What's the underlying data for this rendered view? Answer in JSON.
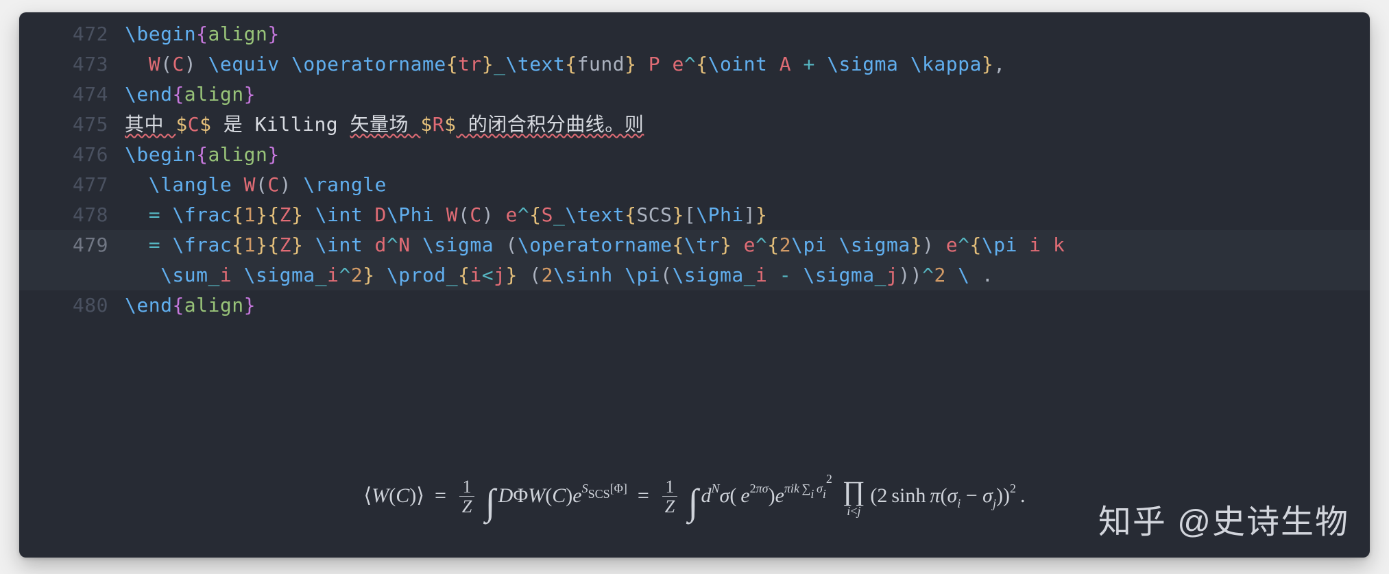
{
  "editor": {
    "line_numbers": [
      "472",
      "473",
      "474",
      "475",
      "476",
      "477",
      "478",
      "479",
      "",
      "480"
    ],
    "current_line_index": 8
  },
  "code": {
    "l472": {
      "space": "",
      "begin": "\\begin",
      "lb": "{",
      "env": "align",
      "rb": "}"
    },
    "l473": {
      "indent": "  ",
      "W": "W",
      "lp": "(",
      "C": "C",
      "rp": ")",
      " ": " ",
      "equiv": "\\equiv",
      " 2": " ",
      "opname": "\\operatorname",
      "lb": "{",
      "tr": "tr",
      "rb": "}",
      "us": "_",
      "text": "\\text",
      "lb2": "{",
      "fund": "fund",
      "rb2": "}",
      " 3": " ",
      "P": "P",
      " 4": " ",
      "e": "e",
      "caret": "^",
      "lb3": "{",
      "oint": "\\oint",
      " 5": " ",
      "A": "A",
      " 6": " ",
      "plus": "+",
      " 7": " ",
      "sigma": "\\sigma",
      " 8": " ",
      "kappa": "\\kappa",
      "rb3": "}",
      "comma": ","
    },
    "l474": {
      "end": "\\end",
      "lb": "{",
      "env": "align",
      "rb": "}"
    },
    "l475": {
      "zh1": "其中 ",
      "d1": "$",
      "C": "C",
      "d2": "$",
      "zh2": " 是 ",
      "kil": "Killing ",
      "zh3": "矢量场 ",
      "d3": "$",
      "R": "R",
      "d4": "$",
      "zh4": " 的闭合积分曲线。则"
    },
    "l476": {
      "begin": "\\begin",
      "lb": "{",
      "env": "align",
      "rb": "}"
    },
    "l477": {
      "indent": "  ",
      "langle": "\\langle",
      " ": " ",
      "W": "W",
      "lp": "(",
      "C": "C",
      "rp": ")",
      " 2": " ",
      "rangle": "\\rangle"
    },
    "l478": {
      "indent": "  ",
      "eq": "=",
      " ": " ",
      "frac": "\\frac",
      "lb1": "{",
      "one": "1",
      "rb1": "}",
      "lb2": "{",
      "Z": "Z",
      "rb2": "}",
      " 2": " ",
      "int": "\\int",
      " 3": " ",
      "D": "D",
      "Phi": "\\Phi",
      " 4": " ",
      "W": "W",
      "lp": "(",
      "C": "C",
      "rp": ")",
      " 5": " ",
      "e": "e",
      "caret": "^",
      "lb3": "{",
      "S": "S",
      "us": "_",
      "text": "\\text",
      "lb4": "{",
      "SCS": "SCS",
      "rb4": "}",
      "lbk": "[",
      "Phi2": "\\Phi",
      "rbk": "]",
      "rb3": "}"
    },
    "l479a": {
      "indent": "  ",
      "eq": "=",
      " ": " ",
      "frac": "\\frac",
      "lb1": "{",
      "one": "1",
      "rb1": "}",
      "lb2": "{",
      "Z": "Z",
      "rb2": "}",
      " 2": " ",
      "int": "\\int",
      " 3": " ",
      "d": "d",
      "caret": "^",
      "N": "N",
      " 4": " ",
      "sigma": "\\sigma",
      " 5": " ",
      "lp": "(",
      "opname": "\\operatorname",
      "lb3": "{",
      "trcmd": "\\tr",
      "rb3": "}",
      " 6": " ",
      "e": "e",
      "caret2": "^",
      "lb4": "{",
      "two": "2",
      "pi": "\\pi",
      " 7": " ",
      "sigma2": "\\sigma",
      "rb4": "}",
      "rp": ")",
      " 8": " ",
      "e2": "e",
      "caret3": "^",
      "lb5": "{",
      "pi2": "\\pi",
      " 9": " ",
      "i": "i",
      " 10": " ",
      "k": "k"
    },
    "l479b": {
      "indent": "   ",
      "sum": "\\sum",
      "us": "_",
      "ii": "i",
      " ": " ",
      "sigma": "\\sigma",
      "us2": "_",
      "ii2": "i",
      "caret": "^",
      "two": "2",
      "rb": "}",
      " 2": " ",
      "prod": "\\prod",
      "us3": "_",
      "lb": "{",
      "ii3": "i",
      "lt": "<",
      "j": "j",
      "rb2": "}",
      " 3": " ",
      "lp": "(",
      "two2": "2",
      "sinh": "\\sinh",
      " 4": " ",
      "pi": "\\pi",
      "lp2": "(",
      "sigma2": "\\sigma",
      "us4": "_",
      "ii4": "i",
      " 5": " ",
      "minus": "-",
      " 6": " ",
      "sigma3": "\\sigma",
      "us5": "_",
      "j2": "j",
      "rp2": ")",
      "rp": ")",
      "caret2": "^",
      "two3": "2",
      " 7": " ",
      "bs": "\\",
      " 8": " ",
      "dot": "."
    },
    "l480": {
      "end": "\\end",
      "lb": "{",
      "env": "align",
      "rb": "}"
    }
  },
  "rendered": {
    "langle": "⟨",
    "W": "W",
    "C": "C",
    "rangle": "⟩",
    "eq": "=",
    "one": "1",
    "Z": "Z",
    "int": "∫",
    "D": "D",
    "Phi": "Φ",
    "e": "e",
    "S": "S",
    "scs": "SCS",
    "lbrack": "[",
    "rbrack": "]",
    "d": "d",
    "N": "N",
    "sigma": "σ",
    "two": "2",
    "pi": "π",
    "i": "i",
    "k": "k",
    "Sigma": "∑",
    "Pi": "∏",
    "lt": "<",
    "j": "j",
    "sinh": "sinh",
    "minus": "−",
    "dot": "."
  },
  "watermark": "知乎 @史诗生物"
}
